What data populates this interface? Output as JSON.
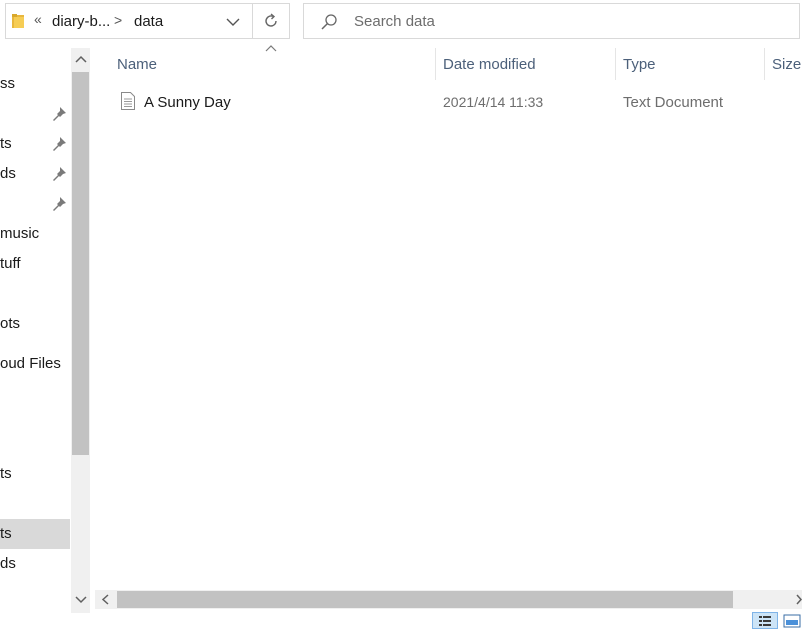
{
  "address_bar": {
    "overflow_glyph": "«",
    "crumbs": [
      "diary-b...",
      "data"
    ],
    "separator": ">"
  },
  "search": {
    "placeholder": "Search data"
  },
  "nav": {
    "items": [
      {
        "label": "ss",
        "pinned": false
      },
      {
        "label": "",
        "pinned": true
      },
      {
        "label": "ts",
        "pinned": true
      },
      {
        "label": "ds",
        "pinned": true
      },
      {
        "label": "",
        "pinned": true
      },
      {
        "label": " music",
        "pinned": false
      },
      {
        "label": "tuff",
        "pinned": false
      },
      {
        "label": "",
        "pinned": false
      },
      {
        "label": "ots",
        "pinned": false
      },
      {
        "label": "",
        "pinned": false
      },
      {
        "label": "oud Files",
        "pinned": false
      },
      {
        "label": "",
        "pinned": false
      },
      {
        "label": "",
        "pinned": false
      },
      {
        "label": "ts",
        "pinned": false
      },
      {
        "label": "",
        "pinned": false
      },
      {
        "label": "ts",
        "pinned": false,
        "selected": true
      },
      {
        "label": "ds",
        "pinned": false
      }
    ]
  },
  "columns": {
    "name": "Name",
    "date": "Date modified",
    "type": "Type",
    "size": "Size"
  },
  "files": [
    {
      "name": "A Sunny Day",
      "date": "2021/4/14 11:33",
      "type": "Text Document"
    }
  ],
  "colors": {
    "header_text": "#4c607a",
    "selection": "#d9d9d9",
    "scrollbar_thumb": "#c2c2c2"
  }
}
